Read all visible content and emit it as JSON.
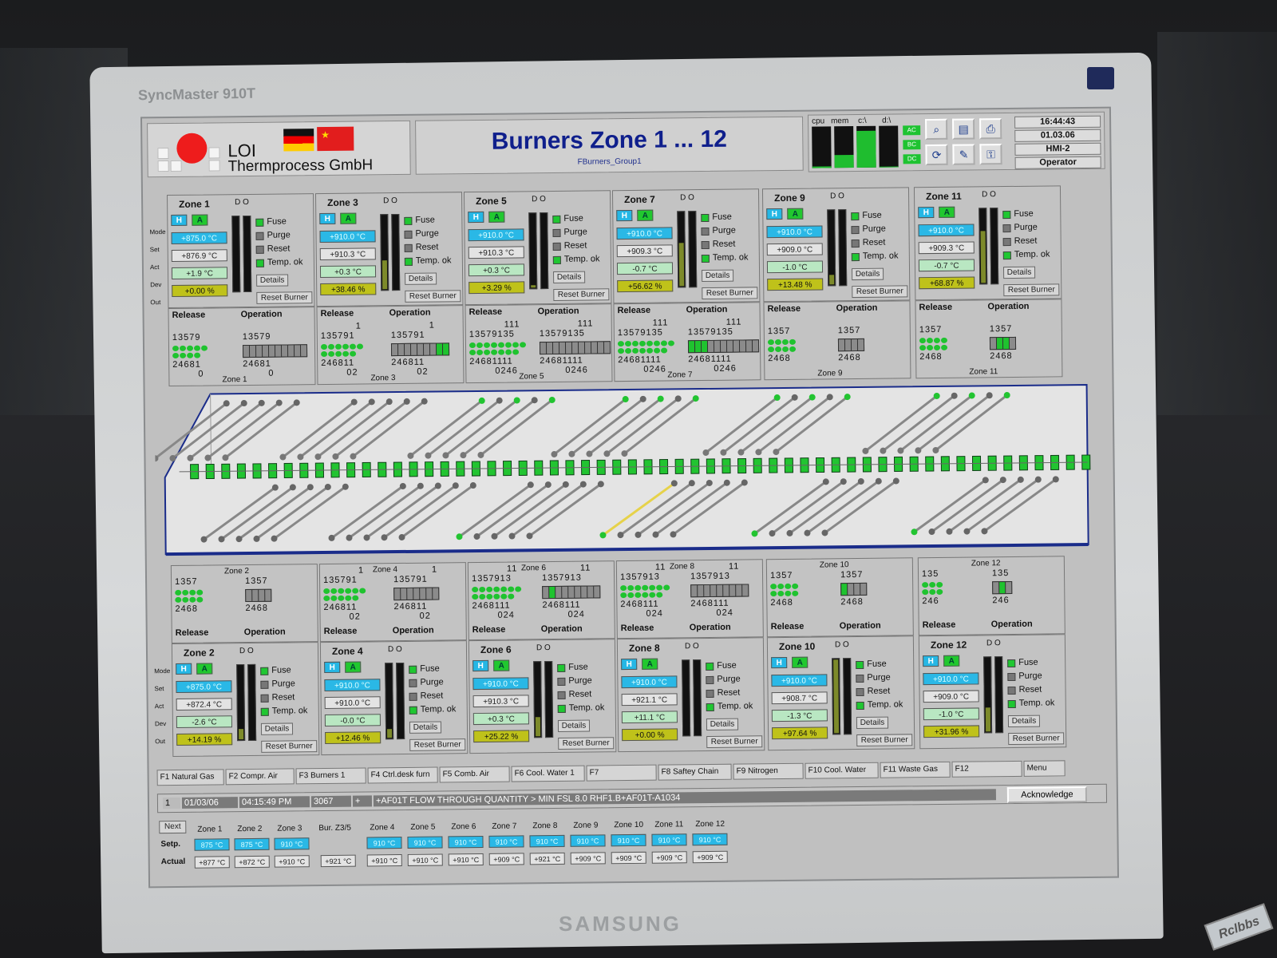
{
  "monitor": {
    "brand": "SyncMaster 910T",
    "maker": "SAMSUNG",
    "watermark": "Rclbbs"
  },
  "header": {
    "company_short": "LOI",
    "company_full": "Thermprocess GmbH",
    "title": "Burners Zone 1 ... 12",
    "subtitle": "FBurners_Group1",
    "sys_labels": [
      "cpu",
      "mem",
      "c:\\",
      "d:\\"
    ],
    "drive_labels": [
      "AC",
      "BC",
      "DC"
    ],
    "time": "16:44:43",
    "date": "01.03.06",
    "station": "HMI-2",
    "user": "Operator"
  },
  "labels": {
    "mode": "Mode",
    "set": "Set",
    "act": "Act",
    "dev": "Dev",
    "out": "Out",
    "h": "H",
    "a": "A",
    "do": "D O",
    "fuse": "Fuse",
    "purge": "Purge",
    "reset": "Reset",
    "temp_ok": "Temp. ok",
    "details": "Details",
    "reset_burner": "Reset Burner",
    "release": "Release",
    "operation": "Operation"
  },
  "zones_top": [
    {
      "name": "Zone 1",
      "set": "+875.0 °C",
      "act": "+876.9 °C",
      "dev": "+1.9 °C",
      "out": "+0.00 %",
      "out_frac": 0.0,
      "top": "",
      "nums1": "13579",
      "nums2": "24681",
      "nums3": "0",
      "dots": 9,
      "grid": "nnnnnnnnnn",
      "label": "Zone 1"
    },
    {
      "name": "Zone 3",
      "set": "+910.0 °C",
      "act": "+910.3 °C",
      "dev": "+0.3 °C",
      "out": "+38.46 %",
      "out_frac": 0.38,
      "top": "1",
      "nums1": "135791",
      "nums2": "246811",
      "nums3": "02",
      "dots": 11,
      "grid": "nnnnnnngg",
      "label": "Zone 3"
    },
    {
      "name": "Zone 5",
      "set": "+910.0 °C",
      "act": "+910.3 °C",
      "dev": "+0.3 °C",
      "out": "+3.29 %",
      "out_frac": 0.03,
      "top": "111",
      "nums1": "13579135",
      "nums2": "24681111",
      "nums3": "0246",
      "dots": 15,
      "grid": "nnnnnnnnnnn",
      "label": "Zone 5"
    },
    {
      "name": "Zone 7",
      "set": "+910.0 °C",
      "act": "+909.3 °C",
      "dev": "-0.7 °C",
      "out": "+56.62 %",
      "out_frac": 0.57,
      "top": "111",
      "nums1": "13579135",
      "nums2": "24681111",
      "nums3": "0246",
      "dots": 15,
      "grid": "gggnnnnnnnn",
      "label": "Zone 7"
    },
    {
      "name": "Zone 9",
      "set": "+910.0 °C",
      "act": "+909.0 °C",
      "dev": "-1.0 °C",
      "out": "+13.48 %",
      "out_frac": 0.13,
      "top": "",
      "nums1": "1357",
      "nums2": "2468",
      "nums3": "",
      "dots": 8,
      "grid": "nnnn",
      "label": "Zone 9"
    },
    {
      "name": "Zone 11",
      "set": "+910.0 °C",
      "act": "+909.3 °C",
      "dev": "-0.7 °C",
      "out": "+68.87 %",
      "out_frac": 0.69,
      "top": "",
      "nums1": "1357",
      "nums2": "2468",
      "nums3": "",
      "dots": 8,
      "grid": "nggn",
      "label": "Zone 11"
    }
  ],
  "zones_bottom": [
    {
      "name": "Zone 2",
      "set": "+875.0 °C",
      "act": "+872.4 °C",
      "dev": "-2.6 °C",
      "out": "+14.19 %",
      "out_frac": 0.14,
      "top": "",
      "nums1": "1357",
      "nums2": "2468",
      "nums3": "",
      "dots": 8,
      "grid": "nnnn",
      "label": "Zone 2"
    },
    {
      "name": "Zone 4",
      "set": "+910.0 °C",
      "act": "+910.0 °C",
      "dev": "-0.0 °C",
      "out": "+12.46 %",
      "out_frac": 0.12,
      "top": "1",
      "nums1": "135791",
      "nums2": "246811",
      "nums3": "02",
      "dots": 11,
      "grid": "nnnnnnn",
      "label": "Zone 4"
    },
    {
      "name": "Zone 6",
      "set": "+910.0 °C",
      "act": "+910.3 °C",
      "dev": "+0.3 °C",
      "out": "+25.22 %",
      "out_frac": 0.25,
      "top": "11",
      "nums1": "1357913",
      "nums2": "2468111",
      "nums3": "024",
      "dots": 13,
      "grid": "ngnnnnnnn",
      "label": "Zone 6"
    },
    {
      "name": "Zone 8",
      "set": "+910.0 °C",
      "act": "+921.1 °C",
      "dev": "+11.1 °C",
      "out": "+0.00 %",
      "out_frac": 0.0,
      "top": "11",
      "nums1": "1357913",
      "nums2": "2468111",
      "nums3": "024",
      "dots": 13,
      "grid": "nnnnnnnnn",
      "label": "Zone 8"
    },
    {
      "name": "Zone 10",
      "set": "+910.0 °C",
      "act": "+908.7 °C",
      "dev": "-1.3 °C",
      "out": "+97.64 %",
      "out_frac": 0.98,
      "top": "",
      "nums1": "1357",
      "nums2": "2468",
      "nums3": "",
      "dots": 8,
      "grid": "gnnn",
      "label": "Zone 10"
    },
    {
      "name": "Zone 12",
      "set": "+910.0 °C",
      "act": "+909.0 °C",
      "dev": "-1.0 °C",
      "out": "+31.96 %",
      "out_frac": 0.32,
      "top": "",
      "nums1": "135",
      "nums2": "246",
      "nums3": "",
      "dots": 6,
      "grid": "ngn",
      "label": "Zone 12"
    }
  ],
  "fkeys": [
    "F1 Natural Gas",
    "F2 Compr. Air",
    "F3 Burners 1",
    "F4 Ctrl.desk furn",
    "F5 Comb. Air",
    "F6 Cool. Water 1",
    "F7",
    "F8 Saftey Chain",
    "F9 Nitrogen",
    "F10 Cool. Water",
    "F11 Waste Gas",
    "F12",
    "Menu"
  ],
  "alarm": {
    "idx": "1",
    "date": "01/03/06",
    "time": "04:15:49 PM",
    "code": "3067",
    "plus": "+",
    "text": "+AF01T FLOW THROUGH QUANTITY > MIN  FSL 8.0 RHF1.B+AF01T-A1034",
    "ack": "Acknowledge"
  },
  "summary": {
    "next": "Next",
    "setp": "Setp.",
    "actual": "Actual",
    "bur": "Bur. Z3/5",
    "zones": [
      "Zone 1",
      "Zone 2",
      "Zone 3",
      "Zone 4",
      "Zone 5",
      "Zone 6",
      "Zone 7",
      "Zone 8",
      "Zone 9",
      "Zone 10",
      "Zone 11",
      "Zone 12"
    ],
    "setp_left": [
      "875 °C",
      "875 °C",
      "910 °C"
    ],
    "setp_right": [
      "910 °C",
      "910 °C",
      "910 °C",
      "910 °C",
      "910 °C",
      "910 °C",
      "910 °C",
      "910 °C",
      "910 °C"
    ],
    "actual_left": [
      "+877 °C",
      "+872 °C",
      "+910 °C"
    ],
    "bur_actual": "+921 °C",
    "actual_right": [
      "+910 °C",
      "+910 °C",
      "+910 °C",
      "+909 °C",
      "+921 °C",
      "+909 °C",
      "+909 °C",
      "+909 °C",
      "+909 °C"
    ]
  }
}
